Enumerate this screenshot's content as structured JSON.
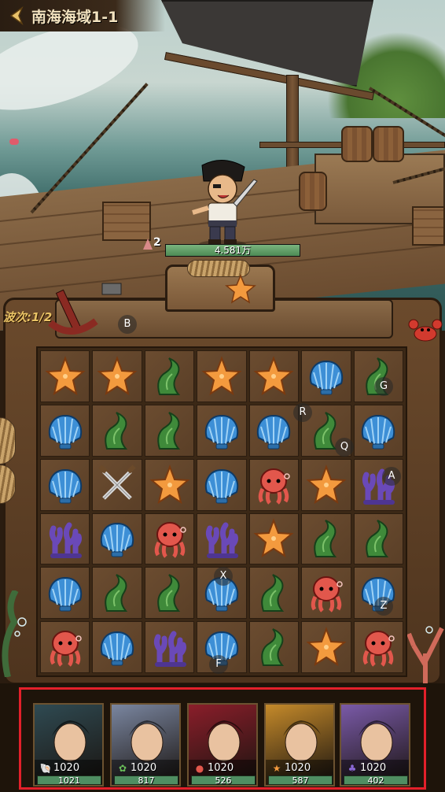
{
  "header": {
    "title": "南海海域1-1"
  },
  "enemy": {
    "level": "2",
    "hp_text": "4.581万",
    "hp_fraction": 1.0
  },
  "wave": {
    "text": "波次:1/2"
  },
  "colors": {
    "frame": "#e3202a",
    "hp_fill": "#5f9e68"
  },
  "board": {
    "rows": [
      [
        "starfish",
        "starfish",
        "seaweed",
        "starfish",
        "starfish",
        "shell",
        "seaweed"
      ],
      [
        "shell",
        "seaweed",
        "seaweed",
        "shell",
        "shell",
        "seaweed",
        "shell"
      ],
      [
        "shell",
        "swords",
        "starfish",
        "shell",
        "octopus",
        "starfish",
        "coral"
      ],
      [
        "coral",
        "shell",
        "octopus",
        "coral",
        "starfish",
        "seaweed",
        "seaweed"
      ],
      [
        "shell",
        "seaweed",
        "seaweed",
        "shell",
        "seaweed",
        "octopus",
        "shell"
      ],
      [
        "octopus",
        "shell",
        "coral",
        "shell",
        "seaweed",
        "starfish",
        "octopus"
      ]
    ]
  },
  "markers": [
    "B",
    "G",
    "R",
    "Q",
    "A",
    "X",
    "Z",
    "F"
  ],
  "heroes": [
    {
      "attack": "1020",
      "hp": "1021",
      "element": "shell",
      "portrait_color": "#2f4a52"
    },
    {
      "attack": "1020",
      "hp": "817",
      "element": "seaweed",
      "portrait_color": "#7a86a0"
    },
    {
      "attack": "1020",
      "hp": "526",
      "element": "octopus",
      "portrait_color": "#8a1e2a"
    },
    {
      "attack": "1020",
      "hp": "587",
      "element": "starfish",
      "portrait_color": "#c58a2a"
    },
    {
      "attack": "1020",
      "hp": "402",
      "element": "coral",
      "portrait_color": "#7a5aa8"
    }
  ]
}
